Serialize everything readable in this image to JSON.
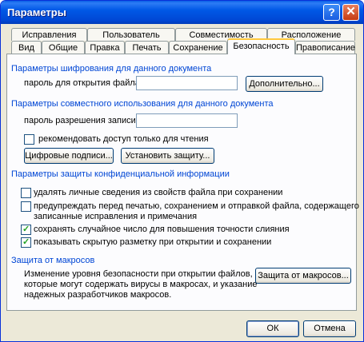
{
  "window": {
    "title": "Параметры"
  },
  "titlebar": {
    "help_glyph": "?",
    "close_glyph": "✕"
  },
  "tabs_row1": [
    "Исправления",
    "Пользователь",
    "Совместимость",
    "Расположение"
  ],
  "tabs_row2": [
    "Вид",
    "Общие",
    "Правка",
    "Печать",
    "Сохранение",
    "Безопасность",
    "Правописание"
  ],
  "active_tab": "Безопасность",
  "encryption": {
    "heading": "Параметры шифрования для данного документа",
    "open_password_label": "пароль для открытия файла:",
    "open_password_value": "",
    "advanced_button": "Дополнительно..."
  },
  "sharing": {
    "heading": "Параметры совместного использования для данного документа",
    "write_password_label": "пароль разрешения записи:",
    "write_password_value": "",
    "read_only_label": "рекомендовать доступ только для чтения",
    "read_only_checked": false,
    "signatures_button": "Цифровые подписи...",
    "protect_button": "Установить защиту..."
  },
  "privacy": {
    "heading": "Параметры защиты конфиденциальной информации",
    "options": [
      {
        "label": "удалять личные сведения из свойств файла при сохранении",
        "checked": false
      },
      {
        "label": "предупреждать перед печатью, сохранением и отправкой файла, содержащего",
        "label2": "записанные исправления и примечания",
        "checked": false
      },
      {
        "label": "сохранять случайное число для повышения точности слияния",
        "checked": true
      },
      {
        "label": "показывать скрытую разметку при открытии и сохранении",
        "checked": true
      }
    ]
  },
  "macro": {
    "heading": "Защита от макросов",
    "description": [
      "Изменение уровня безопасности при открытии файлов,",
      "которые могут содержать вирусы в макросах, и указание",
      "надежных разработчиков макросов."
    ],
    "button": "Защита от макросов..."
  },
  "footer": {
    "ok": "ОК",
    "cancel": "Отмена"
  },
  "colors": {
    "title_bar": "#0058e6",
    "section_heading": "#0046d5",
    "dialog_bg": "#ece9d8",
    "check_mark": "#21a121",
    "active_tab_highlight": "#ffc83c"
  }
}
